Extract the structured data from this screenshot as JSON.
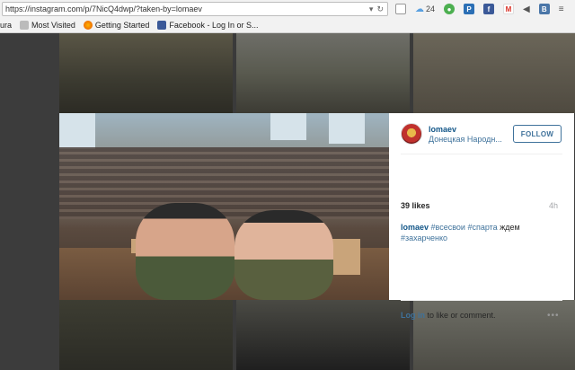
{
  "browser": {
    "url": "https://instagram.com/p/7NicQ4dwp/?taken-by=lomaev",
    "weather_temp": "24",
    "bookmarks": [
      {
        "label": "ura"
      },
      {
        "label": "Most Visited"
      },
      {
        "label": "Getting Started"
      },
      {
        "label": "Facebook - Log In or S..."
      }
    ]
  },
  "post": {
    "username": "lomaev",
    "location": "Донецкая Народн...",
    "follow_label": "FOLLOW",
    "likes": "39 likes",
    "age": "4h",
    "caption": {
      "user": "lomaev",
      "tag1": "#всесвои",
      "tag2": "#спарта",
      "text": "ждем",
      "tag3": "#захарченко"
    },
    "login_link": "Log in",
    "login_text": "to like or comment.",
    "more": "•••"
  },
  "colors": {
    "link": "#3f729b",
    "username": "#125688",
    "muted": "#a5a7aa"
  }
}
